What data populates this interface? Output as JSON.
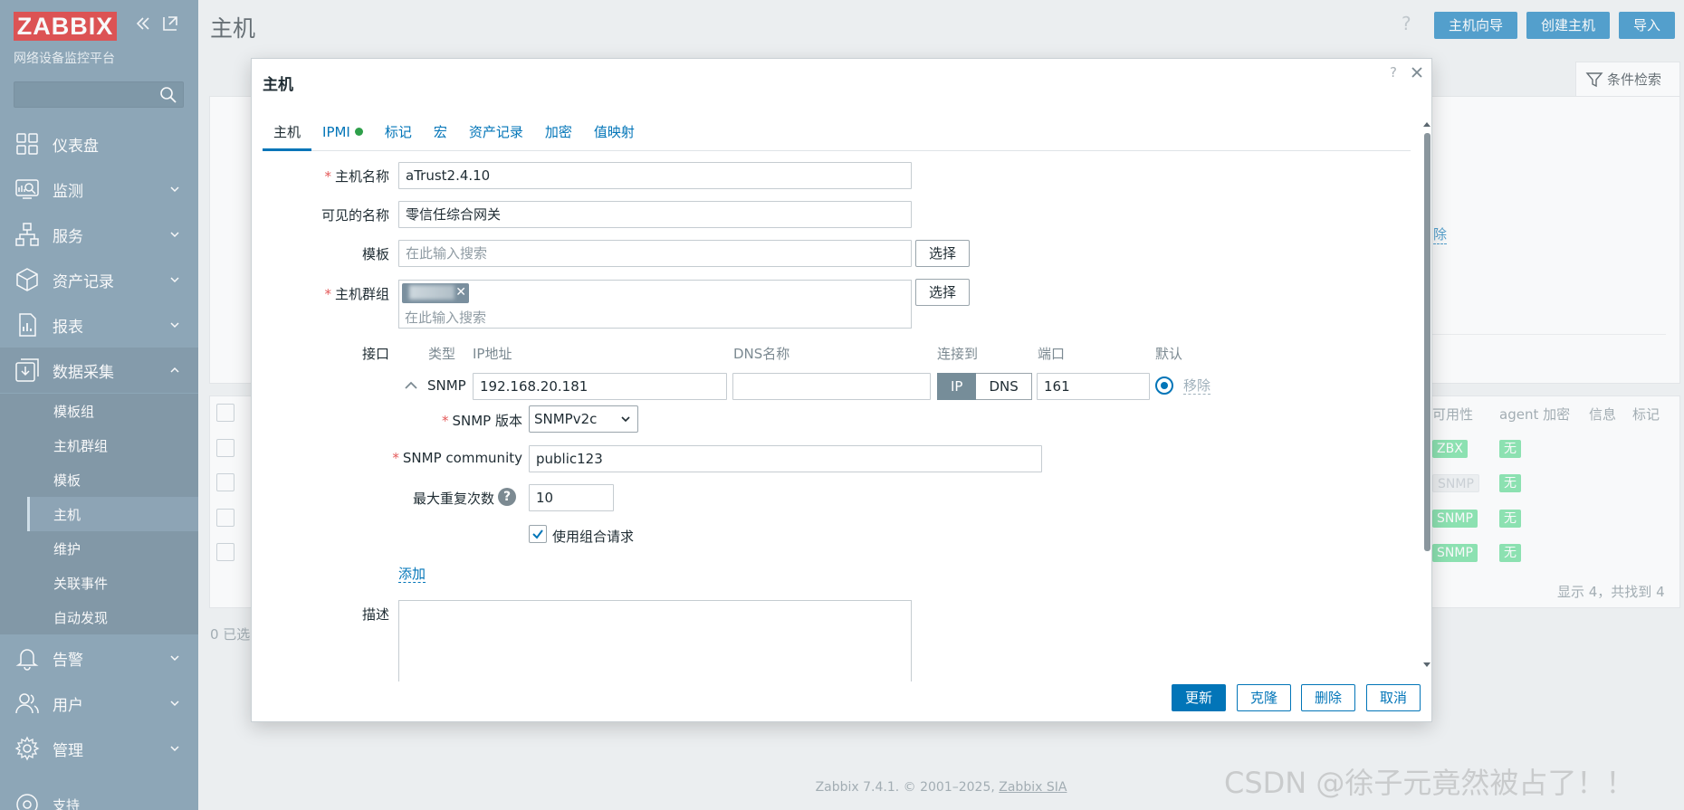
{
  "sidebar": {
    "logo": "ZABBIX",
    "subtitle": "网络设备监控平台",
    "search_placeholder": "",
    "nav": [
      {
        "label": "仪表盘",
        "icon": "dashboard-icon"
      },
      {
        "label": "监测",
        "icon": "monitoring-icon"
      },
      {
        "label": "服务",
        "icon": "services-icon"
      },
      {
        "label": "资产记录",
        "icon": "inventory-icon"
      },
      {
        "label": "报表",
        "icon": "reports-icon"
      },
      {
        "label": "数据采集",
        "icon": "data-collection-icon"
      },
      {
        "label": "告警",
        "icon": "alerts-icon"
      },
      {
        "label": "用户",
        "icon": "users-icon"
      },
      {
        "label": "管理",
        "icon": "administration-icon"
      },
      {
        "label": "支持",
        "icon": "support-icon"
      }
    ],
    "subnav": [
      "模板组",
      "主机群组",
      "模板",
      "主机",
      "维护",
      "关联事件",
      "自动发现"
    ]
  },
  "header": {
    "title": "主机",
    "buttons": [
      "主机向导",
      "创建主机",
      "导入"
    ],
    "filter_label": "条件检索"
  },
  "background": {
    "partial_link": "除",
    "columns": [
      "可用性",
      "agent 加密",
      "信息",
      "标记"
    ],
    "rows": [
      {
        "availability": "ZBX",
        "enc": "无",
        "disabled": false
      },
      {
        "availability": "SNMP",
        "enc": "无",
        "disabled": true
      },
      {
        "availability": "SNMP",
        "enc": "无",
        "disabled": false
      },
      {
        "availability": "SNMP",
        "enc": "无",
        "disabled": false
      }
    ],
    "summary": "显示 4，共找到 4",
    "selected": "0 已选"
  },
  "footer": {
    "text": "Zabbix 7.4.1. © 2001–2025,",
    "link": "Zabbix SIA"
  },
  "watermark": "CSDN @徐子元竟然被占了！！",
  "modal": {
    "title": "主机",
    "help": "?",
    "tabs": [
      "主机",
      "IPMI",
      "标记",
      "宏",
      "资产记录",
      "加密",
      "值映射"
    ],
    "host_name_label": "主机名称",
    "host_name": "aTrust2.4.10",
    "visible_name_label": "可见的名称",
    "visible_name": "零信任综合网关",
    "templates_label": "模板",
    "search_placeholder": "在此输入搜索",
    "select_label": "选择",
    "groups_label": "主机群组",
    "interfaces_label": "接口",
    "iface_columns": {
      "type": "类型",
      "ip": "IP地址",
      "dns": "DNS名称",
      "connect": "连接到",
      "port": "端口",
      "default": "默认"
    },
    "iface": {
      "type": "SNMP",
      "ip": "192.168.20.181",
      "dns": "",
      "connect_ip": "IP",
      "connect_dns": "DNS",
      "port": "161",
      "remove": "移除"
    },
    "snmp_version_label": "SNMP 版本",
    "snmp_version": "SNMPv2c",
    "snmp_community_label": "SNMP community",
    "snmp_community": "public123",
    "max_repetitions_label": "最大重复次数",
    "max_repetitions": "10",
    "bulk_label": "使用组合请求",
    "add_label": "添加",
    "description_label": "描述",
    "buttons": {
      "update": "更新",
      "clone": "克隆",
      "delete": "删除",
      "cancel": "取消"
    }
  }
}
